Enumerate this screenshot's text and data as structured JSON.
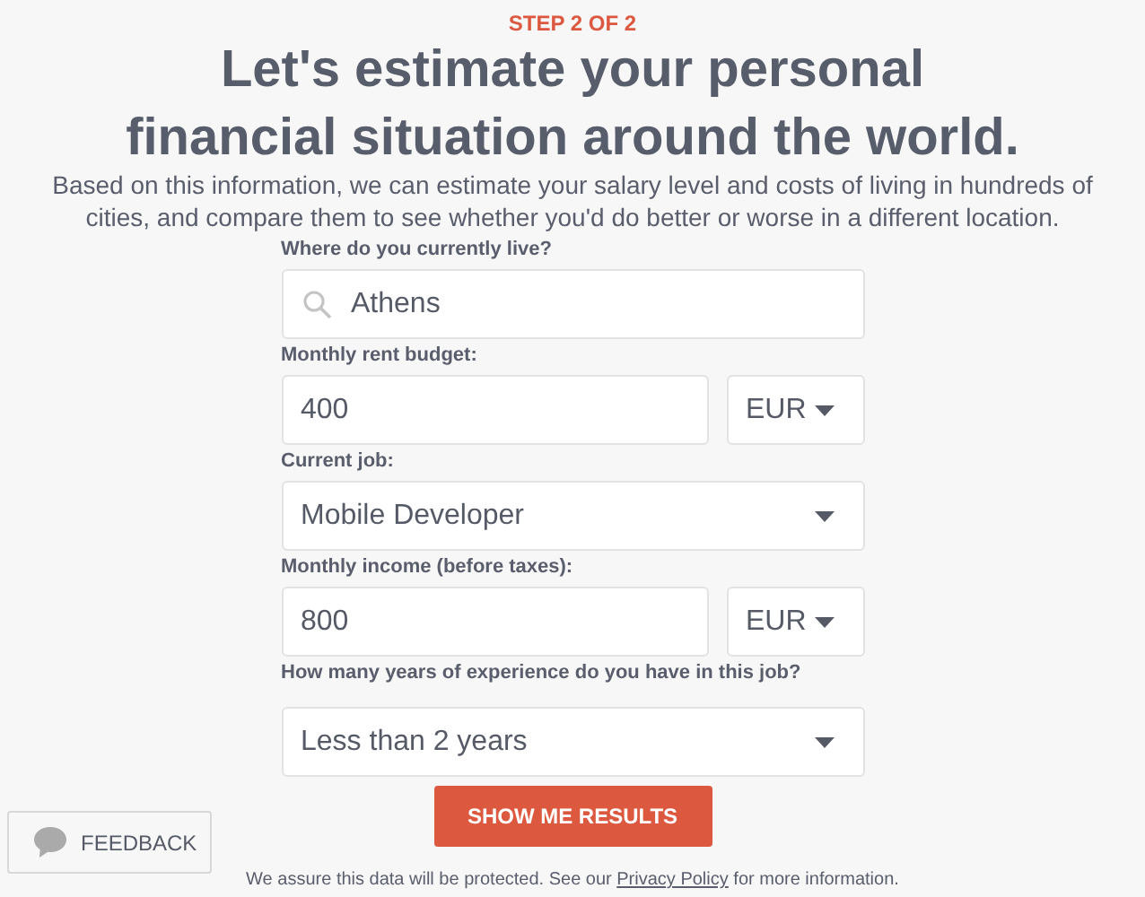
{
  "step": "STEP 2 OF 2",
  "title_lines": [
    "Let's estimate your personal",
    "financial situation around the world."
  ],
  "intro": "Based on this information, we can estimate your salary level and costs of living in hundreds of cities, and compare them to see whether you'd do better or worse in a different location.",
  "fields": [
    {
      "kind": "search",
      "label": "Where do you currently live?",
      "value": "Athens"
    },
    {
      "kind": "amount",
      "label": "Monthly rent budget:",
      "value": "400",
      "currency": "EUR"
    },
    {
      "kind": "select",
      "label": "Current job:",
      "value": "Mobile Developer"
    },
    {
      "kind": "amount",
      "label": "Monthly income (before taxes):",
      "value": "800",
      "currency": "EUR"
    },
    {
      "kind": "select",
      "label": "How many years of experience do you have in this job?",
      "value": "Less than 2 years"
    }
  ],
  "submit": "SHOW ME RESULTS",
  "footer": {
    "before": "We assure this data will be protected. See our ",
    "link": "Privacy Policy",
    "after": " for more information."
  },
  "feedback": "FEEDBACK"
}
